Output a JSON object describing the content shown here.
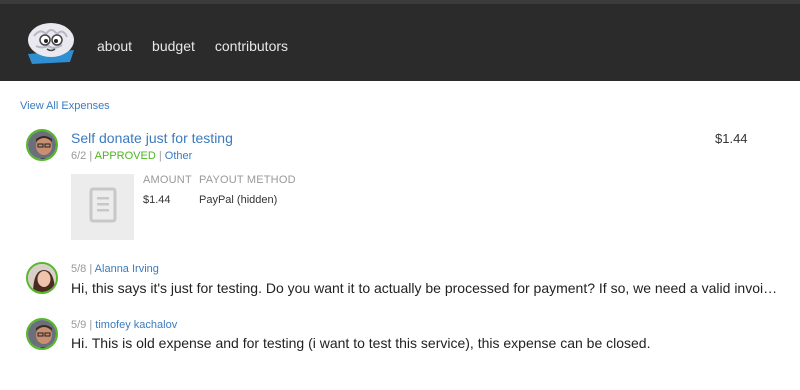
{
  "header": {
    "logo": "brain-mascot-logo",
    "nav": [
      "about",
      "budget",
      "contributors"
    ]
  },
  "links": {
    "view_all": "View All Expenses"
  },
  "expense": {
    "title": "Self donate just for testing",
    "date": "6/2",
    "status": "APPROVED",
    "category": "Other",
    "amount_display": "$1.44",
    "columns": {
      "amount": "AMOUNT",
      "payout_method": "PAYOUT METHOD"
    },
    "values": {
      "amount": "$1.44",
      "payout_method": "PayPal (hidden)"
    },
    "receipt_icon": "document-icon"
  },
  "comments": [
    {
      "date": "5/8",
      "author": "Alanna Irving",
      "text": "Hi, this says it's just for testing. Do you want it to actually be processed for payment? If so, we need a valid invoi…"
    },
    {
      "date": "5/9",
      "author": "timofey kachalov",
      "text": "Hi. This is old expense and for testing (i want to test this service), this expense can be closed."
    }
  ],
  "colors": {
    "header_bg": "#2b2b2b",
    "link": "#3a7bbf",
    "approved": "#4cb51f",
    "avatar_ring": "#55b82a"
  }
}
